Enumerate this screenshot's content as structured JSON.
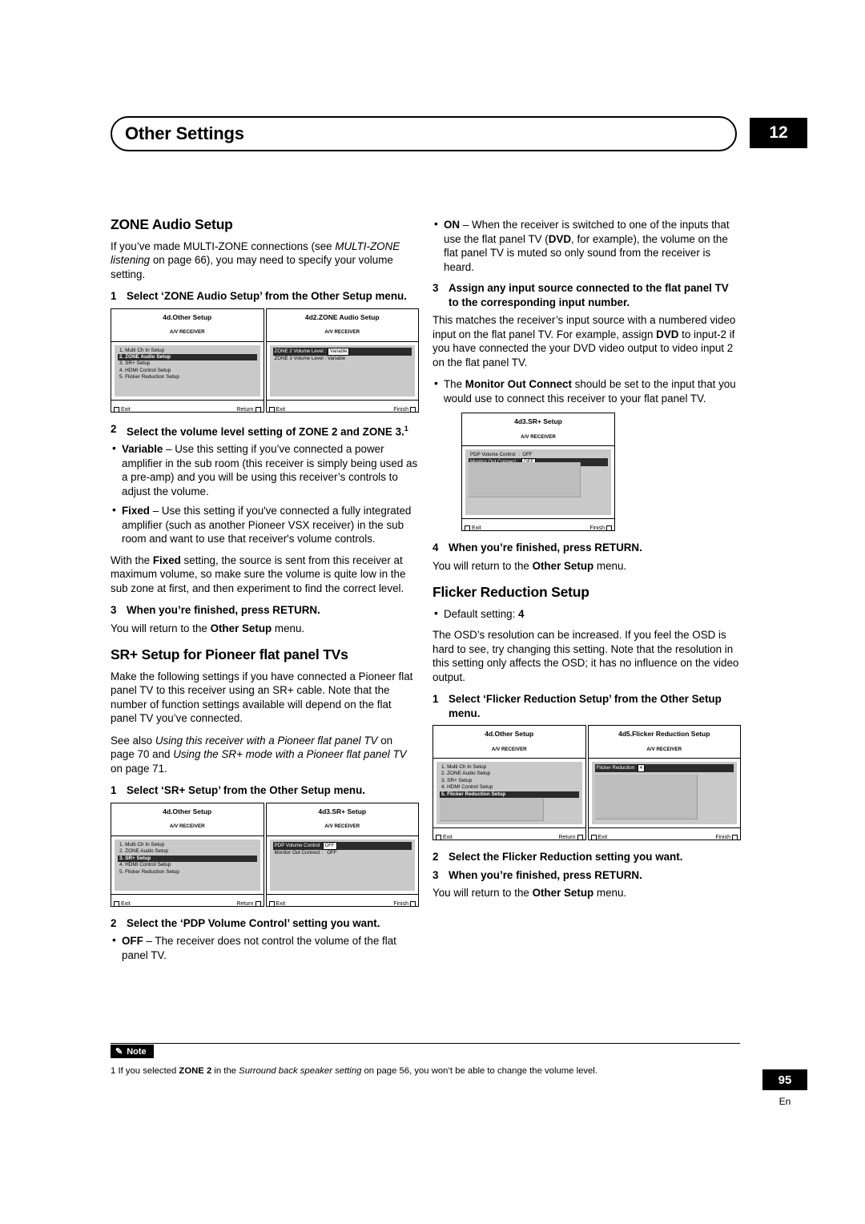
{
  "header": {
    "title": "Other Settings",
    "chapter": "12"
  },
  "left": {
    "zone_heading": "ZONE Audio Setup",
    "zone_intro_1": "If you’ve made MULTI-ZONE connections (see ",
    "zone_intro_italic_1": "MULTI-ZONE listening",
    "zone_intro_2": " on page 66), you may need to specify your volume setting.",
    "step1_num": "1",
    "step1_text": "Select ‘ZONE Audio Setup’ from the Other Setup menu.",
    "osd1": {
      "title": "4d.Other Setup",
      "sub": "A/V RECEIVER",
      "items": [
        "1. Multi Ch In Setup",
        "2. ZONE Audio Setup",
        "3. SR+ Setup",
        "4. HDMI Control Setup",
        "5. Flicker Reduction Setup"
      ],
      "selected": 1,
      "exit": "Exit",
      "foot_right": "Return"
    },
    "osd2": {
      "title": "4d2.ZONE Audio Setup",
      "sub": "A/V RECEIVER",
      "row1_label": "ZONE 2 Volume Level :",
      "row1_value": "Variable",
      "row2_label": "ZONE 3 Volume Level :",
      "row2_value": "Variable",
      "exit": "Exit",
      "foot_right": "Finish"
    },
    "step2_num": "2",
    "step2_text": "Select the volume level setting of ZONE 2 and ZONE 3.",
    "step2_footnote": "1",
    "bullet_variable_bold": "Variable",
    "bullet_variable_text": " – Use this setting if you’ve connected a power amplifier in the sub room (this receiver is simply being used as a pre-amp) and you will be using this receiver’s controls to adjust the volume.",
    "bullet_fixed_bold": "Fixed",
    "bullet_fixed_text": " – Use this setting if you've connected a fully integrated amplifier (such as another Pioneer VSX receiver) in the sub room and want to use that receiver's volume controls.",
    "fixed_para_a": "With the ",
    "fixed_para_bold": "Fixed",
    "fixed_para_b": " setting, the source is sent from this receiver at maximum volume, so make sure the volume is quite low in the sub zone at first, and then experiment to find the correct level.",
    "step3_num": "3",
    "step3_text": "When you’re finished, press RETURN.",
    "step3_after_a": "You will return to the ",
    "step3_after_bold": "Other Setup",
    "step3_after_b": " menu.",
    "srplus_heading": "SR+ Setup for Pioneer flat panel TVs",
    "srplus_p1": "Make the following settings if you have connected a Pioneer flat panel TV to this receiver using an SR+ cable. Note that the number of function settings available will depend on the flat panel TV you’ve connected.",
    "srplus_p2_a": "See also ",
    "srplus_p2_i1": "Using this receiver with a Pioneer flat panel TV",
    "srplus_p2_b": " on page 70 and ",
    "srplus_p2_i2": "Using the SR+ mode with a Pioneer flat panel TV",
    "srplus_p2_c": " on page 71.",
    "srplus_step1_num": "1",
    "srplus_step1_text": "Select ‘SR+ Setup’ from the Other Setup menu.",
    "osd3": {
      "title": "4d.Other Setup",
      "sub": "A/V RECEIVER",
      "items": [
        "1. Multi Ch In Setup",
        "2. ZONE Audio Setup",
        "3. SR+ Setup",
        "4. HDMI Control Setup",
        "5. Flicker Reduction Setup"
      ],
      "selected": 2,
      "exit": "Exit",
      "foot_right": "Return"
    },
    "osd4": {
      "title": "4d3.SR+ Setup",
      "sub": "A/V RECEIVER",
      "row1_label": "PDP Volume Control",
      "row1_value": "OFF",
      "row2_label": "Monitor Out Connect :",
      "row2_value": "OFF",
      "exit": "Exit",
      "foot_right": "Finish"
    },
    "srplus_step2_num": "2",
    "srplus_step2_text": "Select the ‘PDP Volume Control’ setting you want.",
    "srplus_off_bold": "OFF",
    "srplus_off_text": " – The receiver does not control the volume of the flat panel TV."
  },
  "right": {
    "on_bold": "ON",
    "on_text_a": " – When the receiver is switched to one of the inputs that use the flat panel TV (",
    "on_dvd": "DVD",
    "on_text_b": ", for example), the volume on the flat panel TV is muted so only sound from the receiver is heard.",
    "step3_num": "3",
    "step3_text": "Assign any input source connected to the flat panel TV to the corresponding input number.",
    "step3_p_a": "This matches the receiver’s input source with a numbered video input on the flat panel TV. For example, assign ",
    "step3_p_dvd": "DVD",
    "step3_p_b": " to input-2 if you have connected the your DVD video output to video input 2 on the flat panel TV.",
    "monitor_bullet_a": "The ",
    "monitor_bullet_bold": "Monitor Out Connect",
    "monitor_bullet_b": " should be set to the input that you would use to connect this receiver to your flat panel TV.",
    "osd5": {
      "title": "4d3.SR+ Setup",
      "sub": "A/V RECEIVER",
      "row1_label": "PDP Volume Control",
      "row1_value": "OFF",
      "row2_label": "Monitor Out Connect :",
      "row2_value": "OFF",
      "exit": "Exit",
      "foot_right": "Finish"
    },
    "step4_num": "4",
    "step4_text": "When you’re finished, press RETURN.",
    "step4_after_a": "You will return to the ",
    "step4_after_bold": "Other Setup",
    "step4_after_b": " menu.",
    "flicker_heading": "Flicker Reduction Setup",
    "flicker_default_a": "Default setting: ",
    "flicker_default_b": "4",
    "flicker_p": "The OSD’s resolution can be increased. If you feel the OSD is hard to see, try changing this setting. Note that the resolution in this setting only affects the OSD; it has no influence on the video output.",
    "flicker_step1_num": "1",
    "flicker_step1_text": "Select ‘Flicker Reduction Setup’ from the Other Setup menu.",
    "osd6": {
      "title": "4d.Other Setup",
      "sub": "A/V RECEIVER",
      "items": [
        "1. Multi Ch In Setup",
        "2. ZONE Audio Setup",
        "3. SR+ Setup",
        "4. HDMI Control Setup",
        "5. Flicker Reduction Setup"
      ],
      "selected": 4,
      "exit": "Exit",
      "foot_right": "Return"
    },
    "osd7": {
      "title": "4d5.Flicker Reduction Setup",
      "sub": "A/V RECEIVER",
      "row1_label": "Flicker Reduction",
      "row1_value": "4",
      "exit": "Exit",
      "foot_right": "Finish"
    },
    "flicker_step2_num": "2",
    "flicker_step2_text": "Select the Flicker Reduction setting you want.",
    "flicker_step3_num": "3",
    "flicker_step3_text": "When you’re finished, press RETURN.",
    "flicker_step3_after_a": "You will return to the ",
    "flicker_step3_after_bold": "Other Setup",
    "flicker_step3_after_b": " menu."
  },
  "footer": {
    "note_label": "Note",
    "note_num": "1",
    "note_a": "If you selected ",
    "note_zone2": "ZONE 2",
    "note_b": " in the ",
    "note_italic": "Surround back speaker setting",
    "note_c": " on page 56, you won’t be able to change the volume level.",
    "page_number": "95",
    "language": "En"
  }
}
